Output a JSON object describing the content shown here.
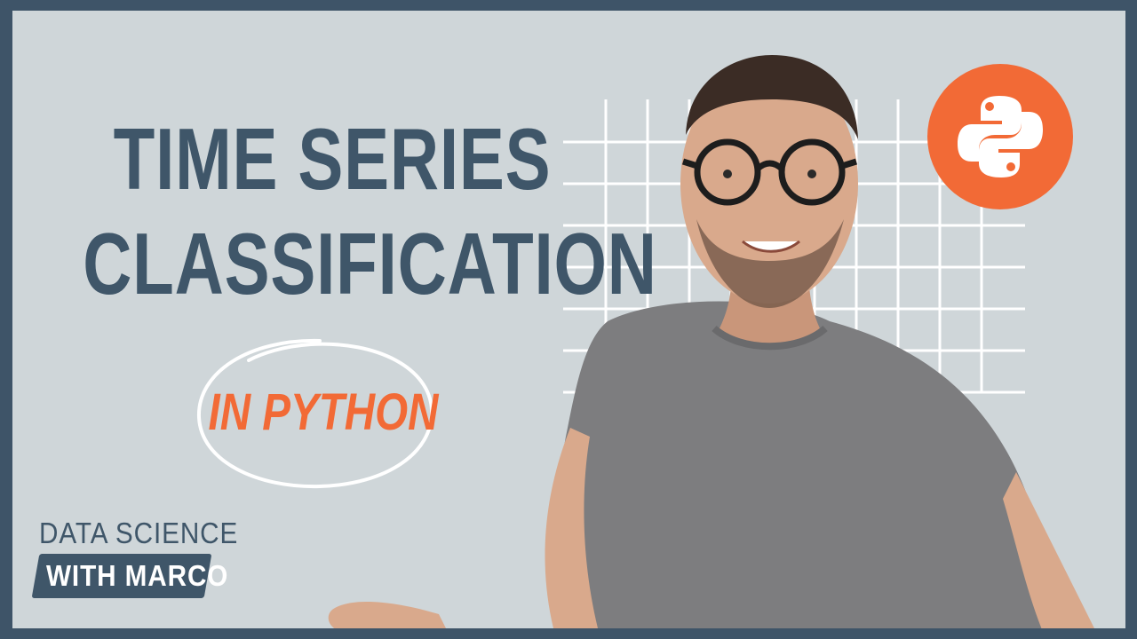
{
  "title": {
    "line1": "TIME SERIES",
    "line2": "CLASSIFICATION"
  },
  "subtitle": "IN PYTHON",
  "brand": {
    "line1": "DATA SCIENCE",
    "line2": "WITH MARCO"
  },
  "icons": {
    "logo": "python-logo-icon"
  },
  "colors": {
    "background": "#cfd6d9",
    "border": "#3e5468",
    "title": "#3f5669",
    "accent": "#f26a36",
    "grid": "#ffffff",
    "shirt": "#7d7d7f",
    "skin": "#d9a98c"
  }
}
